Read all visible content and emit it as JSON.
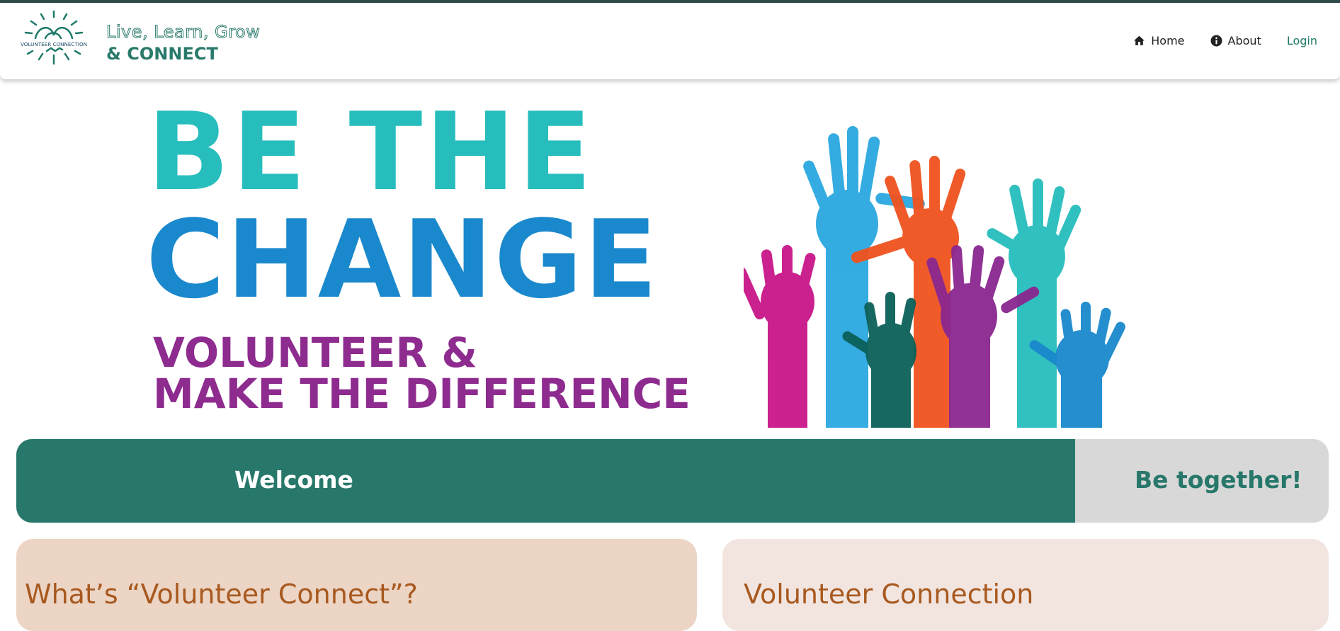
{
  "header": {
    "logo_text": "VOLUNTEER CONNECTION",
    "tagline_line1": "Live, Learn, Grow",
    "tagline_line2": "& CONNECT",
    "nav": [
      {
        "label": "Home",
        "icon": "home-icon"
      },
      {
        "label": "About",
        "icon": "info-icon"
      },
      {
        "label": "Login",
        "icon": ""
      }
    ]
  },
  "hero": {
    "line1": "BE THE",
    "line2": "CHANGE",
    "line3": "VOLUNTEER &",
    "line4": "MAKE THE DIFFERENCE",
    "colors": {
      "teal": "#27bdbd",
      "blue": "#1a88cc",
      "purple": "#8e2b8f"
    }
  },
  "banner": {
    "welcome": "Welcome",
    "together": "Be together!"
  },
  "cards": [
    {
      "title": "What’s “Volunteer Connect”?"
    },
    {
      "title": "Volunteer Connection"
    }
  ],
  "colors": {
    "brand_green": "#27786a",
    "card_title": "#a8591f",
    "card_left_bg": "#ecd5c5",
    "card_right_bg": "#f2e5df"
  }
}
